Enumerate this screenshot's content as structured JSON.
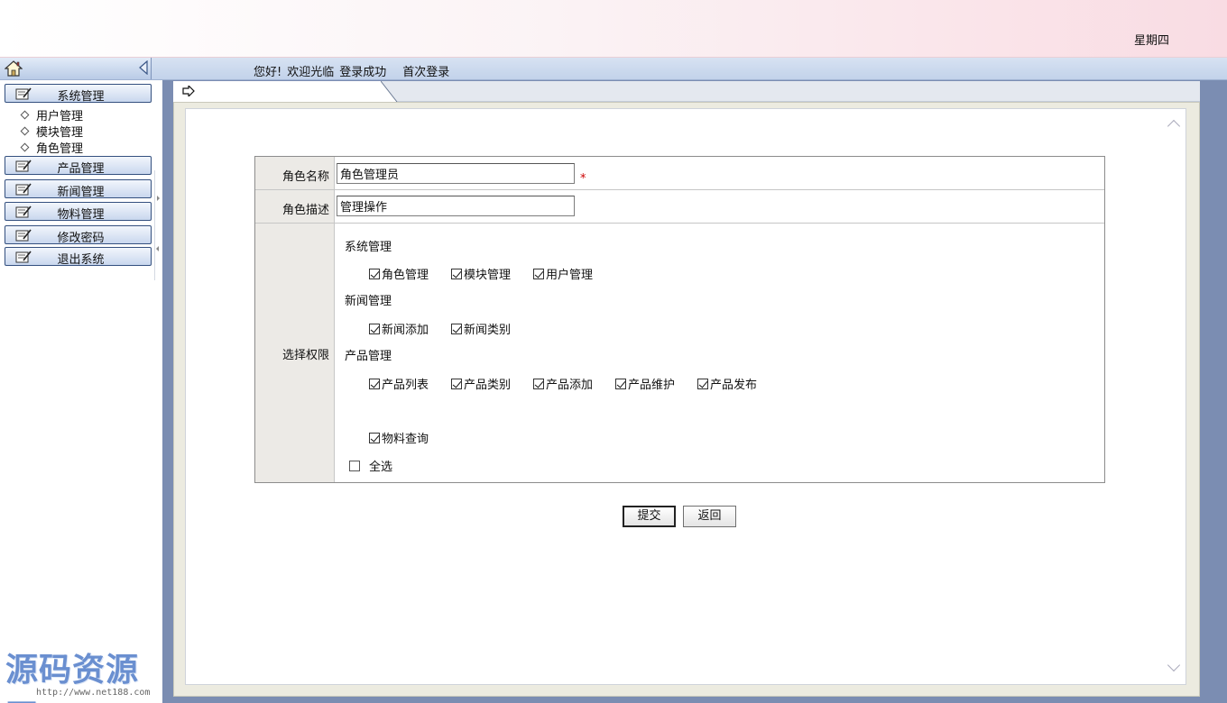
{
  "header": {
    "weekday": "星期四"
  },
  "welcome": {
    "greeting": "您好!",
    "welcome": "欢迎光临",
    "status": "登录成功",
    "first_login": "首次登录"
  },
  "sidebar": {
    "menus": [
      {
        "label": "系统管理",
        "sub_items": [
          "用户管理",
          "模块管理",
          "角色管理"
        ]
      },
      {
        "label": "产品管理"
      },
      {
        "label": "新闻管理"
      },
      {
        "label": "物料管理"
      },
      {
        "label": "修改密码"
      },
      {
        "label": "退出系统"
      }
    ]
  },
  "watermark": {
    "text": "源码资源网",
    "url": "http://www.net188.com"
  },
  "form": {
    "role_name_label": "角色名称",
    "role_name_value": "角色管理员",
    "required_mark": "*",
    "role_desc_label": "角色描述",
    "role_desc_value": "管理操作",
    "perm_label": "选择权限",
    "groups": [
      {
        "title": "系统管理",
        "items": [
          {
            "label": "角色管理",
            "checked": true
          },
          {
            "label": "模块管理",
            "checked": true
          },
          {
            "label": "用户管理",
            "checked": true
          }
        ]
      },
      {
        "title": "新闻管理",
        "items": [
          {
            "label": "新闻添加",
            "checked": true
          },
          {
            "label": "新闻类别",
            "checked": true
          }
        ]
      },
      {
        "title": "产品管理",
        "items": [
          {
            "label": "产品列表",
            "checked": true
          },
          {
            "label": "产品类别",
            "checked": true
          },
          {
            "label": "产品添加",
            "checked": true
          },
          {
            "label": "产品维护",
            "checked": true
          },
          {
            "label": "产品发布",
            "checked": true
          }
        ]
      },
      {
        "title": "",
        "items": [
          {
            "label": "物料查询",
            "checked": true
          }
        ]
      }
    ],
    "select_all": {
      "label": "全选",
      "checked": false
    },
    "submit_label": "提交",
    "back_label": "返回"
  },
  "colors": {
    "frame": "#7b8db2",
    "label_bg": "#eceae6",
    "required": "#cc0000"
  }
}
